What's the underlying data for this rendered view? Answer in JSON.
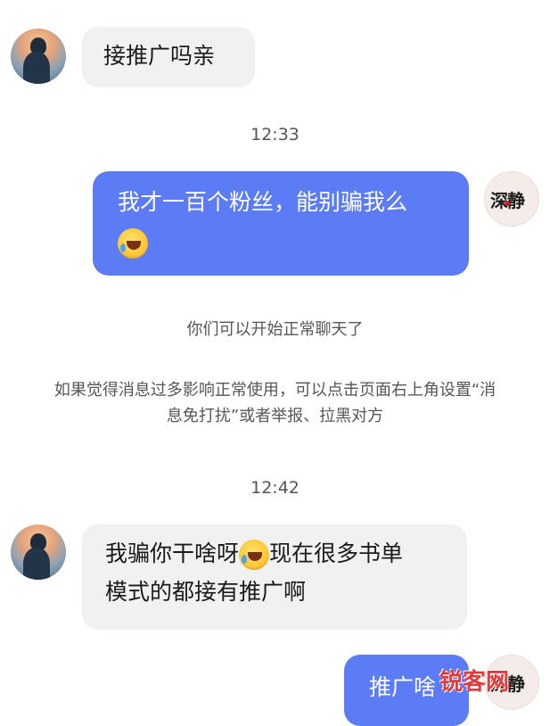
{
  "messages": [
    {
      "text": "接推广吗亲"
    },
    {
      "timestamp": "12:33"
    },
    {
      "text": "我才一百个粉丝，能别骗我么"
    },
    {
      "system": "你们可以开始正常聊天了"
    },
    {
      "system_line1": "如果觉得消息过多影响正常使用，可以点击页面右上角设置“消",
      "system_line2": "息免打扰”或者举报、拉黑对方"
    },
    {
      "timestamp": "12:42"
    },
    {
      "text_part1": "我骗你干啥呀",
      "text_part2": "现在很多书单",
      "text_line2": "模式的都接有推广啊"
    },
    {
      "text": "推广啥"
    }
  ],
  "avatars": {
    "right_text": "深静"
  },
  "watermark": "锐客网",
  "icons": {
    "laugh_emoji": "rofl-emoji-icon"
  },
  "colors": {
    "sent_bubble": "#5b7cf5",
    "received_bubble": "#f1f1f1",
    "timestamp": "#555555"
  }
}
